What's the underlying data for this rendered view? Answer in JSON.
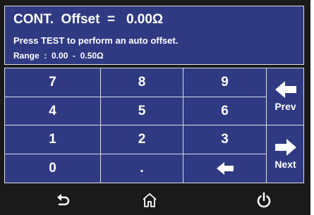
{
  "header": {
    "title": "CONT.  Offset  =   0.00Ω",
    "instruction": "Press TEST to perform an auto offset.",
    "range": "Range  :  0.00  -  0.50Ω"
  },
  "keypad": {
    "row1": [
      "7",
      "8",
      "9"
    ],
    "row2": [
      "4",
      "5",
      "6"
    ],
    "row3": [
      "1",
      "2",
      "3"
    ],
    "row4": [
      "0",
      "."
    ]
  },
  "side": {
    "prev_label": "Prev",
    "next_label": "Next"
  },
  "icons": {
    "backspace": "left-arrow-icon",
    "prev": "left-arrow-icon",
    "next": "right-arrow-icon",
    "back": "undo-icon",
    "home": "home-icon",
    "power": "power-icon"
  },
  "colors": {
    "panel": "#2f3a82",
    "border": "#dcdcec",
    "background": "#1a1a1a",
    "text": "#ffffff"
  }
}
